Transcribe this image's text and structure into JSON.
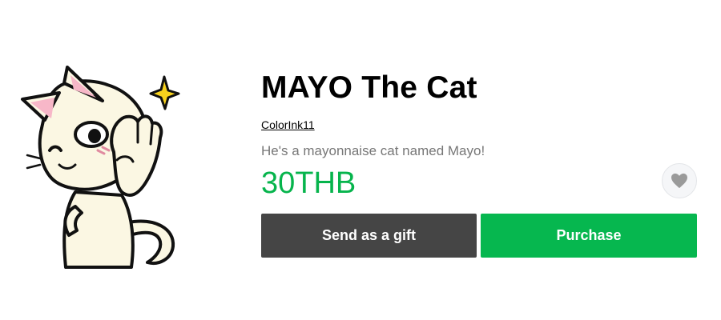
{
  "product": {
    "title": "MAYO The Cat",
    "author": "ColorInk11",
    "description": "He's a mayonnaise cat named Mayo!",
    "price": "30THB"
  },
  "actions": {
    "gift_label": "Send as a gift",
    "purchase_label": "Purchase"
  },
  "icons": {
    "favorite": "heart-icon",
    "sticker_sparkle": "sparkle-icon"
  },
  "colors": {
    "price": "#06b44c",
    "purchase_button": "#06b74f",
    "gift_button": "#454545",
    "favorite_icon": "#9a9a9a"
  }
}
